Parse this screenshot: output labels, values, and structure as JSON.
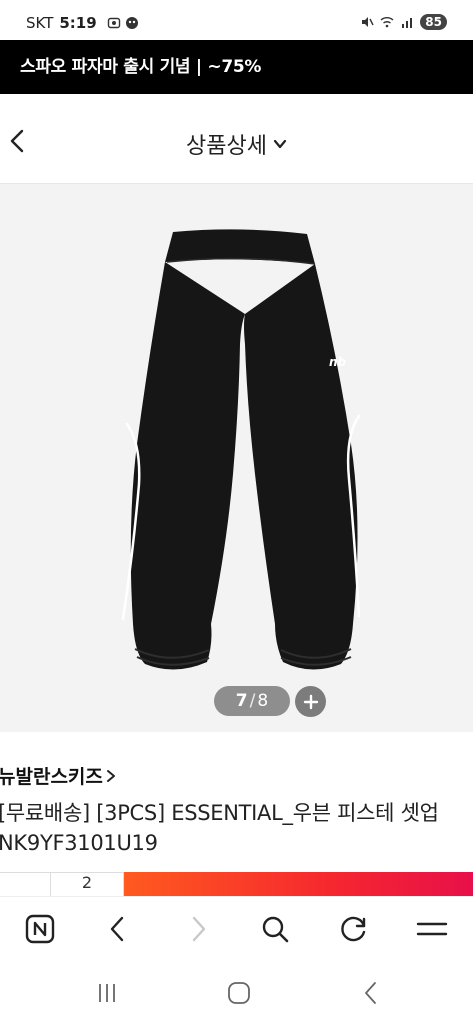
{
  "status_bar": {
    "carrier": "SKT",
    "time": "5:19",
    "battery": "85"
  },
  "promo_banner": {
    "text": "스파오 파자마 출시 기념 | ~75%"
  },
  "header": {
    "title": "상품상세"
  },
  "product": {
    "image_index": "7",
    "image_separator": "/",
    "image_total": "8",
    "brand": "뉴발란스키즈",
    "name_line1": "[무료배송] [3PCS] ESSENTIAL_우븐 피스테 셋업",
    "name_line2": "NK9YF3101U19",
    "image_colors": {
      "background": "#f3f3f3",
      "garment": "#161616",
      "piping": "#ffffff"
    }
  },
  "purchase_bar": {
    "qty_partial": "2",
    "gradient_start": "#ff5a1f",
    "gradient_end": "#e8104a"
  },
  "browser_nav": {
    "icons": [
      "naver-home-icon",
      "back-icon",
      "forward-icon",
      "search-icon",
      "refresh-icon",
      "menu-icon"
    ]
  },
  "system_nav": {
    "icons": [
      "recent-apps-icon",
      "home-icon",
      "back-icon"
    ]
  }
}
